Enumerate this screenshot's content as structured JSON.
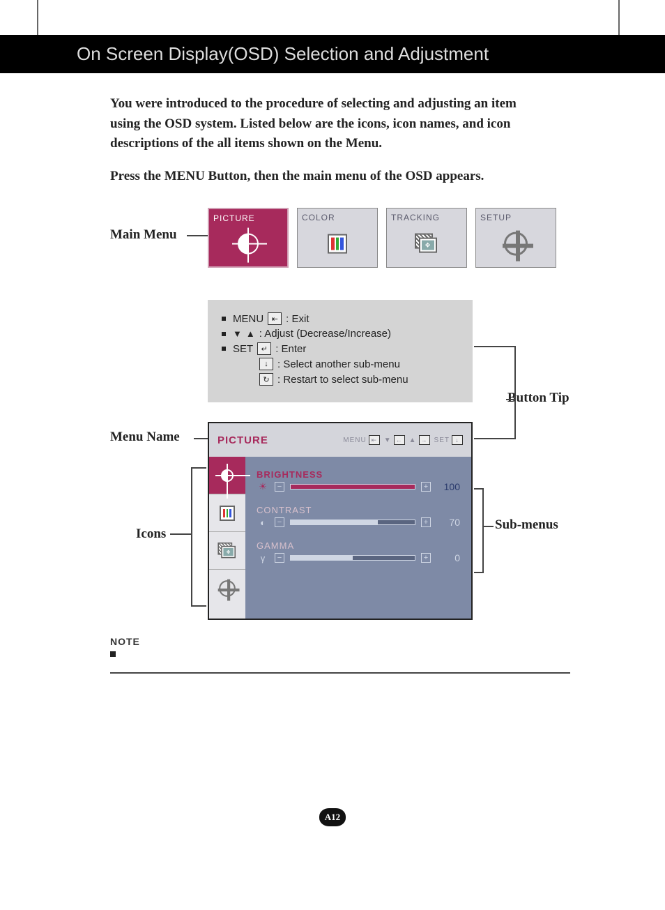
{
  "header": {
    "title": "On Screen Display(OSD) Selection and Adjustment"
  },
  "intro": {
    "p1": "You were introduced to the procedure of selecting and adjusting an item using the OSD system.  Listed below are the icons, icon names, and icon descriptions of the all items shown on the Menu.",
    "p2": "Press the MENU Button, then the main menu of the OSD appears."
  },
  "callouts": {
    "main_menu": "Main Menu",
    "button_tip": "Button Tip",
    "menu_name": "Menu Name",
    "sub_menus": "Sub-menus",
    "icons": "Icons"
  },
  "tabs": [
    {
      "label": "PICTURE",
      "active": true
    },
    {
      "label": "COLOR",
      "active": false
    },
    {
      "label": "TRACKING",
      "active": false
    },
    {
      "label": "SETUP",
      "active": false
    }
  ],
  "tips": {
    "menu_word": "MENU",
    "menu_desc": ": Exit",
    "adjust_desc": ": Adjust (Decrease/Increase)",
    "set_word": "SET",
    "set_desc": ": Enter",
    "select_desc": ": Select another sub-menu",
    "restart_desc": ": Restart to select sub-menu"
  },
  "osd": {
    "menu_name": "PICTURE",
    "titlebar_menu": "MENU",
    "titlebar_set": "SET",
    "items": [
      {
        "name": "BRIGHTNESS",
        "value": 100,
        "symbol": "☀",
        "active": true
      },
      {
        "name": "CONTRAST",
        "value": 70,
        "symbol": "◐",
        "active": false
      },
      {
        "name": "GAMMA",
        "value": 0,
        "symbol": "γ",
        "active": false
      }
    ]
  },
  "note": {
    "label": "NOTE"
  },
  "page": {
    "number": "A12"
  }
}
